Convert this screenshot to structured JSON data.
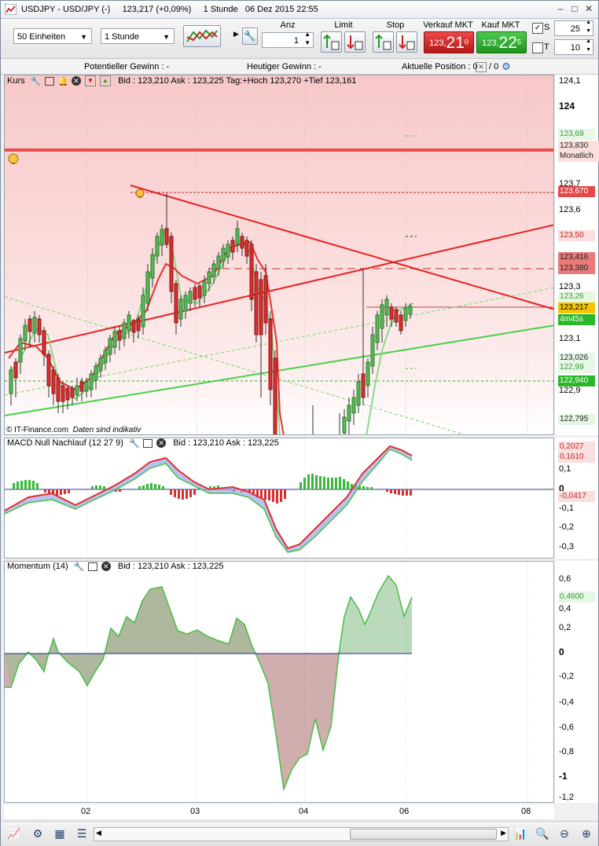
{
  "window": {
    "title": "USDJPY - USD/JPY (-)",
    "price": "123,217 (+0,09%)",
    "interval": "1 Stunde",
    "datetime": "06 Dez 2015 22:55",
    "minimize": "–",
    "maximize": "□",
    "close": "✕"
  },
  "toolbar": {
    "units_value": "50 Einheiten",
    "timeframe_value": "1 Stunde",
    "anz_label": "Anz",
    "anz_value": "1",
    "limit_label": "Limit",
    "stop_label": "Stop",
    "sell_label": "Verkauf MKT",
    "sell_small": "123,",
    "sell_big": "21",
    "sell_sup": "0",
    "buy_label": "Kauf MKT",
    "buy_small": "123,",
    "buy_big": "22",
    "buy_sup": "5",
    "s_label": "S",
    "s_value": "25",
    "t_label": "T",
    "t_value": "10"
  },
  "infobar": {
    "potential": "Potentieller Gewinn : -",
    "today": "Heutiger Gewinn : -",
    "position": "Aktuelle Position : 0",
    "position_right": "/ 0"
  },
  "price_panel": {
    "name": "Kurs",
    "quote": "Bid : 123,210 Ask : 123,225 Tag:+Hoch 123,270 +Tief 123,161",
    "credit": "© IT-Finance.com",
    "note": "Daten sind indikativ",
    "axis_labels": [
      "124,1",
      "124",
      "123,7",
      "123,6",
      "123,3",
      "123,1",
      "122,9"
    ],
    "axis_boxes": {
      "b1": "123,69",
      "b2": "123,830",
      "b2b": "Monatlich",
      "b3": "123,670",
      "b4": "123,50",
      "b5": "123,416",
      "b6": "123,380",
      "b7": "123,26",
      "b8": "123,217",
      "b9": "4m45s",
      "b10": "123,026",
      "b11": "122,99",
      "b12": "122,940",
      "b13": "122,795"
    }
  },
  "macd_panel": {
    "name": "MACD Null Nachlauf (12 27 9)",
    "quote": "Bid : 123,210 Ask : 123,225",
    "axis_labels": [
      "0,1",
      "0",
      "-0,1",
      "-0,2",
      "-0,3"
    ],
    "boxes": {
      "v1": "0,2027",
      "v2": "0,1610",
      "v3": "-0,0417"
    }
  },
  "momentum_panel": {
    "name": "Momentum (14)",
    "quote": "Bid : 123,210 Ask : 123,225",
    "axis_labels": [
      "0,6",
      "0,4",
      "0,2",
      "0",
      "-0,2",
      "-0,4",
      "-0,6",
      "-0,8",
      "-1",
      "-1,2"
    ],
    "box": "0,4600"
  },
  "x_axis": [
    "02",
    "03",
    "04",
    "06",
    "08"
  ],
  "icons": [
    "chart-icon",
    "settings-icon",
    "alarm-icon",
    "bell-icon",
    "zoom-in-icon",
    "zoom-out-icon",
    "search-icon"
  ]
}
